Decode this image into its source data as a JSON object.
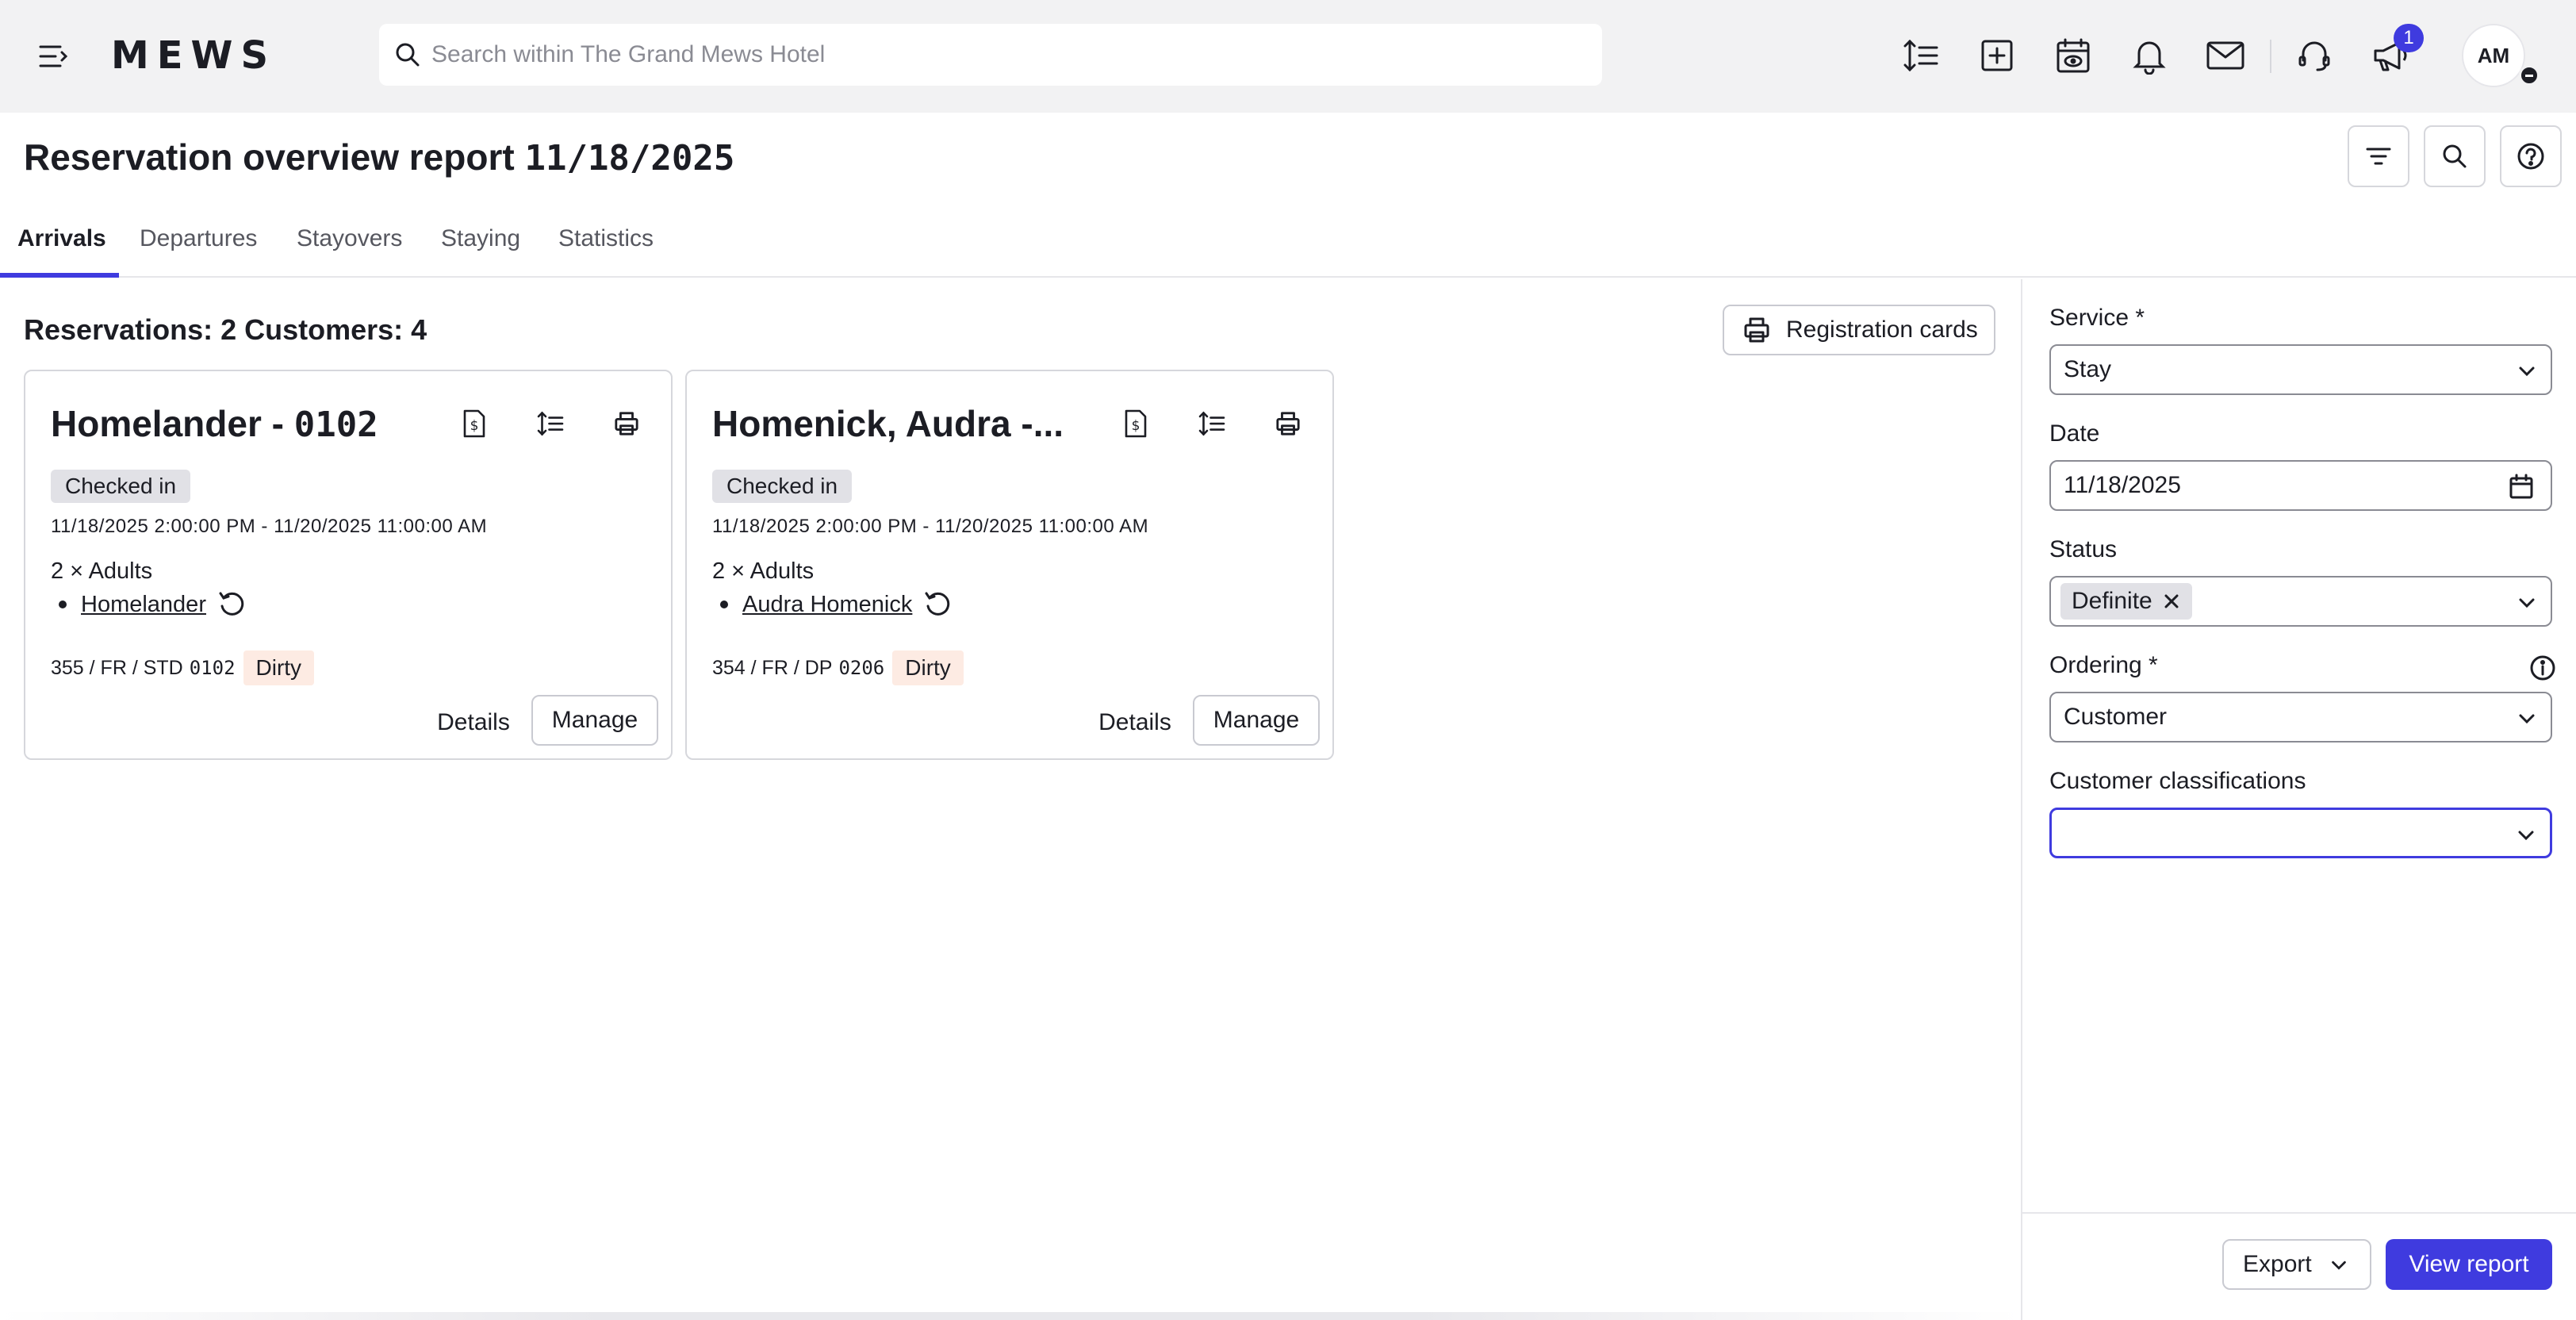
{
  "topbar": {
    "logo": "MEWS",
    "search_placeholder": "Search within The Grand Mews Hotel",
    "notification_badge": "1",
    "avatar_initials": "AM"
  },
  "header": {
    "title_prefix": "Reservation overview report",
    "title_date": "11/18/2025"
  },
  "tabs": [
    {
      "label": "Arrivals",
      "active": true
    },
    {
      "label": "Departures",
      "active": false
    },
    {
      "label": "Stayovers",
      "active": false
    },
    {
      "label": "Staying",
      "active": false
    },
    {
      "label": "Statistics",
      "active": false
    }
  ],
  "summary": "Reservations: 2 Customers: 4",
  "registration_cards_label": "Registration cards",
  "cards": [
    {
      "title_name": "Homelander - ",
      "title_room": "0102",
      "status": "Checked in",
      "dates": "11/18/2025 2:00:00 PM - 11/20/2025 11:00:00 AM",
      "adults": "2 × Adults",
      "guest": "Homelander",
      "room_prefix": "355 / FR / STD",
      "room_number": "0102",
      "housekeeping": "Dirty",
      "details_label": "Details",
      "manage_label": "Manage"
    },
    {
      "title_name": "Homenick, Audra -...",
      "title_room": "",
      "status": "Checked in",
      "dates": "11/18/2025 2:00:00 PM - 11/20/2025 11:00:00 AM",
      "adults": "2 × Adults",
      "guest": "Audra Homenick",
      "room_prefix": "354 / FR / DP",
      "room_number": "0206",
      "housekeeping": "Dirty",
      "details_label": "Details",
      "manage_label": "Manage"
    }
  ],
  "filters": {
    "service_label": "Service *",
    "service_value": "Stay",
    "date_label": "Date",
    "date_value": "11/18/2025",
    "status_label": "Status",
    "status_tag": "Definite",
    "ordering_label": "Ordering *",
    "ordering_value": "Customer",
    "classifications_label": "Customer classifications",
    "classifications_value": ""
  },
  "footer": {
    "export_label": "Export",
    "view_report_label": "View report"
  },
  "colors": {
    "accent": "#3f3bdf",
    "topbar_bg": "#f2f2f3",
    "status_chip_bg": "#e1e1e6",
    "dirty_bg": "#fdebe3"
  }
}
